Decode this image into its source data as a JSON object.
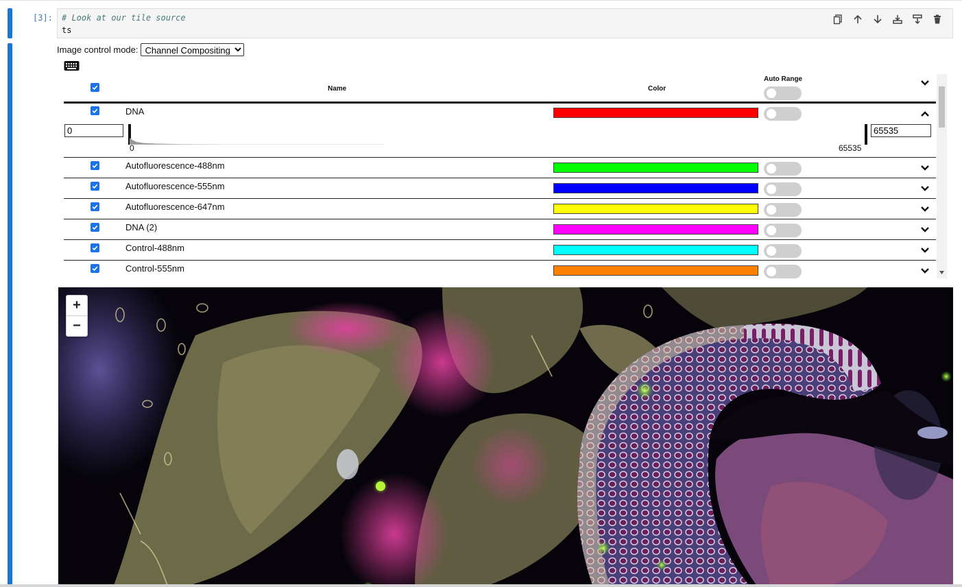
{
  "cell": {
    "prompt": "[3]:",
    "code_comment": "# Look at our tile source",
    "code_text": "ts"
  },
  "toolbar_icons": [
    "copy-icon",
    "arrow-up-icon",
    "arrow-down-icon",
    "insert-above-icon",
    "insert-below-icon",
    "trash-icon"
  ],
  "mode": {
    "label": "Image control mode:",
    "selected": "Channel Compositing"
  },
  "table": {
    "header_name": "Name",
    "header_color": "Color",
    "header_auto_range": "Auto Range",
    "expanded": {
      "min_value": "0",
      "max_value": "65535",
      "hist_min_label": "0",
      "hist_max_label": "65535"
    },
    "channels": [
      {
        "name": "DNA",
        "color": "#ff0000",
        "checked": true,
        "expanded": true
      },
      {
        "name": "Autofluorescence-488nm",
        "color": "#00ff00",
        "checked": true,
        "expanded": false
      },
      {
        "name": "Autofluorescence-555nm",
        "color": "#0000ff",
        "checked": true,
        "expanded": false
      },
      {
        "name": "Autofluorescence-647nm",
        "color": "#ffff00",
        "checked": true,
        "expanded": false
      },
      {
        "name": "DNA (2)",
        "color": "#ff00ff",
        "checked": true,
        "expanded": false
      },
      {
        "name": "Control-488nm",
        "color": "#00ffff",
        "checked": true,
        "expanded": false
      },
      {
        "name": "Control-555nm",
        "color": "#ff8000",
        "checked": true,
        "expanded": false
      }
    ]
  },
  "map": {
    "zoom_in": "+",
    "zoom_out": "−"
  }
}
